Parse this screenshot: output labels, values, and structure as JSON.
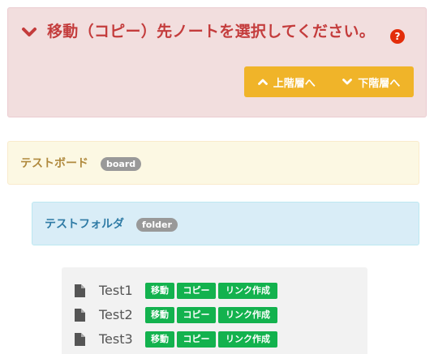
{
  "dialog": {
    "title": "移動（コピー）先ノートを選択してください。",
    "help_icon_glyph": "?",
    "up_button": "上階層へ",
    "down_button": "下階層へ"
  },
  "board": {
    "name": "テストボード",
    "badge": "board"
  },
  "folder": {
    "name": "テストフォルダ",
    "badge": "folder"
  },
  "notes": [
    {
      "name": "Test1",
      "move": "移動",
      "copy": "コピー",
      "link": "リンク作成"
    },
    {
      "name": "Test2",
      "move": "移動",
      "copy": "コピー",
      "link": "リンク作成"
    },
    {
      "name": "Test3",
      "move": "移動",
      "copy": "コピー",
      "link": "リンク作成"
    }
  ],
  "colors": {
    "alert_bg": "#f2dede",
    "alert_text": "#c43c3c",
    "nav_button": "#f0b429",
    "board_bg": "#fcf8e3",
    "folder_bg": "#d9edf7",
    "action_button": "#13b24e",
    "badge": "#999999"
  },
  "icons": {
    "title": "chevron-down-icon",
    "help": "question-circle-icon",
    "up": "chevron-up-icon",
    "down": "chevron-down-icon",
    "note": "file-icon"
  }
}
